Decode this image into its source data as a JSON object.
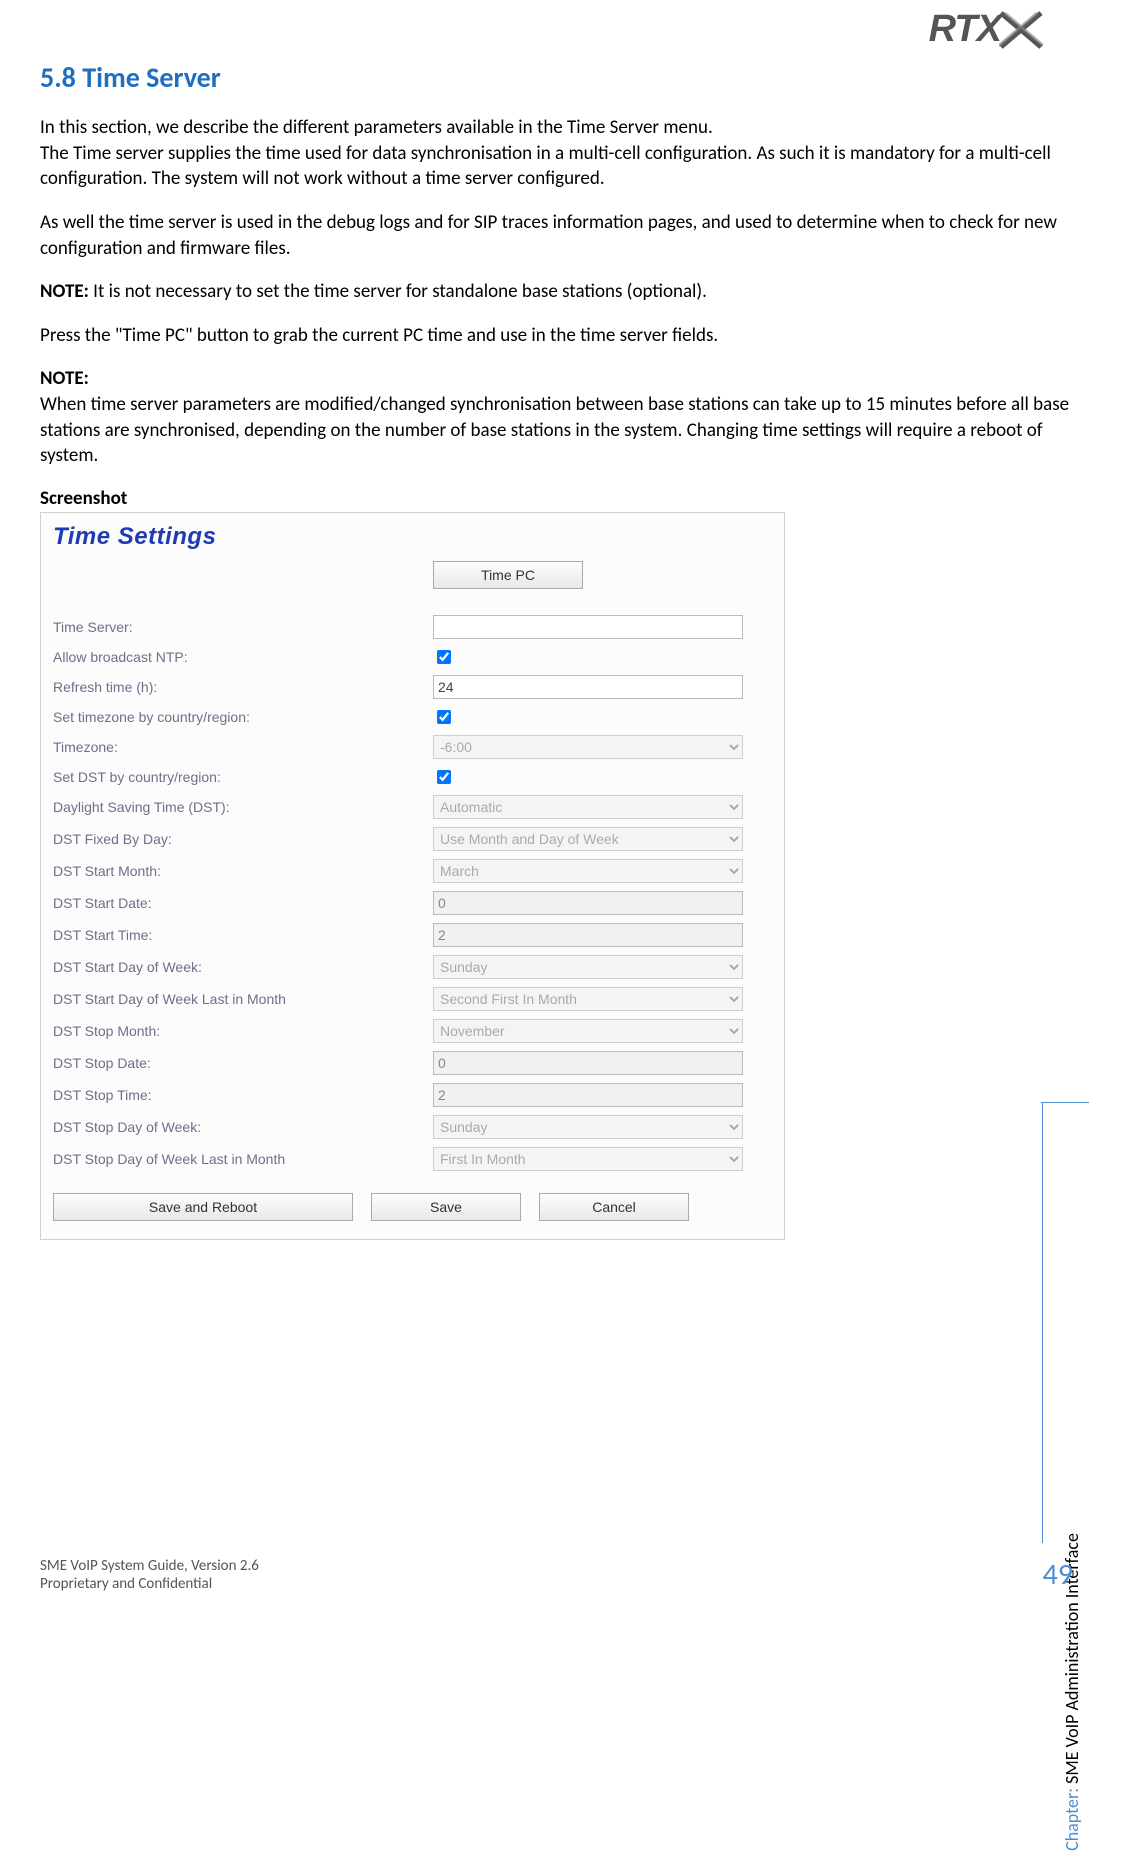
{
  "logo_text": "RTX",
  "section": {
    "number": "5.8",
    "title": "Time Server",
    "para1": "In this section, we describe the different parameters available in the Time Server menu.",
    "para2": "The Time server supplies the time used for data synchronisation in a multi-cell configuration. As such it is mandatory for a multi-cell configuration. The system will not work without a time server configured.",
    "para3": "As well the time server is used in the debug logs and for SIP traces information pages, and used to determine when to check for new configuration and firmware files.",
    "note1_label": "NOTE:",
    "note1_text": " It is not necessary to set the time server for standalone base stations (optional).",
    "para4": "Press the \"Time PC\" button to grab the current PC time and use in the time server fields.",
    "note2_label": "NOTE:",
    "note2_text": "When time server parameters are modified/changed synchronisation between base stations can take up to 15 minutes before all base stations are synchronised, depending on the number of base stations in the system. Changing time settings will require a reboot of system.",
    "screenshot_label": "Screenshot"
  },
  "shot": {
    "title": "Time Settings",
    "time_pc_btn": "Time PC",
    "fields": {
      "time_server": {
        "label": "Time Server:",
        "value": ""
      },
      "allow_ntp": {
        "label": "Allow broadcast NTP:",
        "checked": true
      },
      "refresh_time": {
        "label": "Refresh time (h):",
        "value": "24"
      },
      "set_tz_region": {
        "label": "Set timezone by country/region:",
        "checked": true
      },
      "timezone": {
        "label": "Timezone:",
        "value": "-6:00"
      },
      "set_dst_region": {
        "label": "Set DST by country/region:",
        "checked": true
      },
      "dst": {
        "label": "Daylight Saving Time (DST):",
        "value": "Automatic"
      },
      "dst_fixed_by_day": {
        "label": "DST Fixed By Day:",
        "value": "Use Month and Day of Week"
      },
      "dst_start_month": {
        "label": "DST Start Month:",
        "value": "March"
      },
      "dst_start_date": {
        "label": "DST Start Date:",
        "value": "0"
      },
      "dst_start_time": {
        "label": "DST Start Time:",
        "value": "2"
      },
      "dst_start_dow": {
        "label": "DST Start Day of Week:",
        "value": "Sunday"
      },
      "dst_start_dow_last": {
        "label": "DST Start Day of Week Last in Month",
        "value": "Second First In Month"
      },
      "dst_stop_month": {
        "label": "DST Stop Month:",
        "value": "November"
      },
      "dst_stop_date": {
        "label": "DST Stop Date:",
        "value": "0"
      },
      "dst_stop_time": {
        "label": "DST Stop Time:",
        "value": "2"
      },
      "dst_stop_dow": {
        "label": "DST Stop Day of Week:",
        "value": "Sunday"
      },
      "dst_stop_dow_last": {
        "label": "DST Stop Day of Week Last in Month",
        "value": "First In Month"
      }
    },
    "buttons": {
      "save_reboot": "Save and Reboot",
      "save": "Save",
      "cancel": "Cancel"
    }
  },
  "footer": {
    "line1": "SME VoIP System Guide, Version 2.6",
    "line2": "Proprietary and Confidential"
  },
  "sidebar": {
    "chapter_label": "Chapter:",
    "chapter_title": " SME VoIP Administration Interface"
  },
  "page_number": "49"
}
